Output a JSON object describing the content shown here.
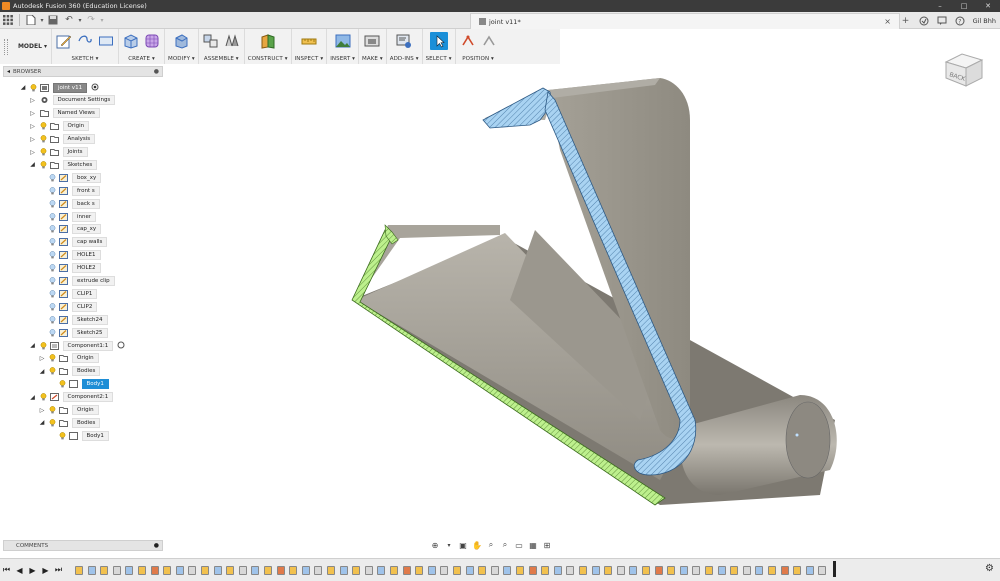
{
  "window": {
    "title": "Autodesk Fusion 360 (Education License)",
    "minimize": "–",
    "maximize": "□",
    "close": "✕"
  },
  "tab": {
    "name": "joint v11*",
    "close": "×"
  },
  "user": {
    "name": "Gil Bhh"
  },
  "workspace": {
    "label": "MODEL ▾"
  },
  "toolbar": {
    "groups": [
      {
        "label": "SKETCH ▾"
      },
      {
        "label": "CREATE ▾"
      },
      {
        "label": "MODIFY ▾"
      },
      {
        "label": "ASSEMBLE ▾"
      },
      {
        "label": "CONSTRUCT ▾"
      },
      {
        "label": "INSPECT ▾"
      },
      {
        "label": "INSERT ▾"
      },
      {
        "label": "MAKE ▾"
      },
      {
        "label": "ADD-INS ▾"
      },
      {
        "label": "SELECT ▾"
      },
      {
        "label": "POSITION ▾"
      }
    ]
  },
  "viewcube": {
    "face": "BACK"
  },
  "browser": {
    "title": "BROWSER",
    "items": [
      {
        "label": "joint v11",
        "depth": 0,
        "arrow": "◢",
        "icon": "root"
      },
      {
        "label": "Document Settings",
        "depth": 1,
        "arrow": "▷",
        "icon": "gear"
      },
      {
        "label": "Named Views",
        "depth": 1,
        "arrow": "▷",
        "icon": "folder"
      },
      {
        "label": "Origin",
        "depth": 1,
        "arrow": "▷",
        "icon": "folder"
      },
      {
        "label": "Analysis",
        "depth": 1,
        "arrow": "▷",
        "icon": "folder"
      },
      {
        "label": "Joints",
        "depth": 1,
        "arrow": "▷",
        "icon": "folder"
      },
      {
        "label": "Sketches",
        "depth": 1,
        "arrow": "◢",
        "icon": "folder"
      },
      {
        "label": "box_xy",
        "depth": 2,
        "arrow": "",
        "icon": "sketch"
      },
      {
        "label": "front s",
        "depth": 2,
        "arrow": "",
        "icon": "sketch"
      },
      {
        "label": "back s",
        "depth": 2,
        "arrow": "",
        "icon": "sketch"
      },
      {
        "label": "inner",
        "depth": 2,
        "arrow": "",
        "icon": "sketch"
      },
      {
        "label": "cap_xy",
        "depth": 2,
        "arrow": "",
        "icon": "sketch"
      },
      {
        "label": "cap walls",
        "depth": 2,
        "arrow": "",
        "icon": "sketch"
      },
      {
        "label": "HOLE1",
        "depth": 2,
        "arrow": "",
        "icon": "sketch"
      },
      {
        "label": "HOLE2",
        "depth": 2,
        "arrow": "",
        "icon": "sketch"
      },
      {
        "label": "extrude clip",
        "depth": 2,
        "arrow": "",
        "icon": "sketch"
      },
      {
        "label": "CLIP1",
        "depth": 2,
        "arrow": "",
        "icon": "sketch"
      },
      {
        "label": "CLIP2",
        "depth": 2,
        "arrow": "",
        "icon": "sketch"
      },
      {
        "label": "Sketch24",
        "depth": 2,
        "arrow": "",
        "icon": "sketch"
      },
      {
        "label": "Sketch25",
        "depth": 2,
        "arrow": "",
        "icon": "sketch"
      },
      {
        "label": "Component1:1",
        "depth": 1,
        "arrow": "◢",
        "icon": "component"
      },
      {
        "label": "Origin",
        "depth": 2,
        "arrow": "▷",
        "icon": "folder"
      },
      {
        "label": "Bodies",
        "depth": 2,
        "arrow": "◢",
        "icon": "folder"
      },
      {
        "label": "Body1",
        "depth": 3,
        "arrow": "",
        "icon": "body",
        "selected": true
      },
      {
        "label": "Component2:1",
        "depth": 1,
        "arrow": "◢",
        "icon": "component2"
      },
      {
        "label": "Origin",
        "depth": 2,
        "arrow": "▷",
        "icon": "folder"
      },
      {
        "label": "Bodies",
        "depth": 2,
        "arrow": "◢",
        "icon": "folder"
      },
      {
        "label": "Body1",
        "depth": 3,
        "arrow": "",
        "icon": "body"
      }
    ]
  },
  "comments": {
    "title": "COMMENTS"
  },
  "colors": {
    "accent": "#1e8ed6",
    "body_grey": "#8f8a80",
    "section_blue": "#9fcdf0",
    "section_green": "#b8ec8a"
  }
}
